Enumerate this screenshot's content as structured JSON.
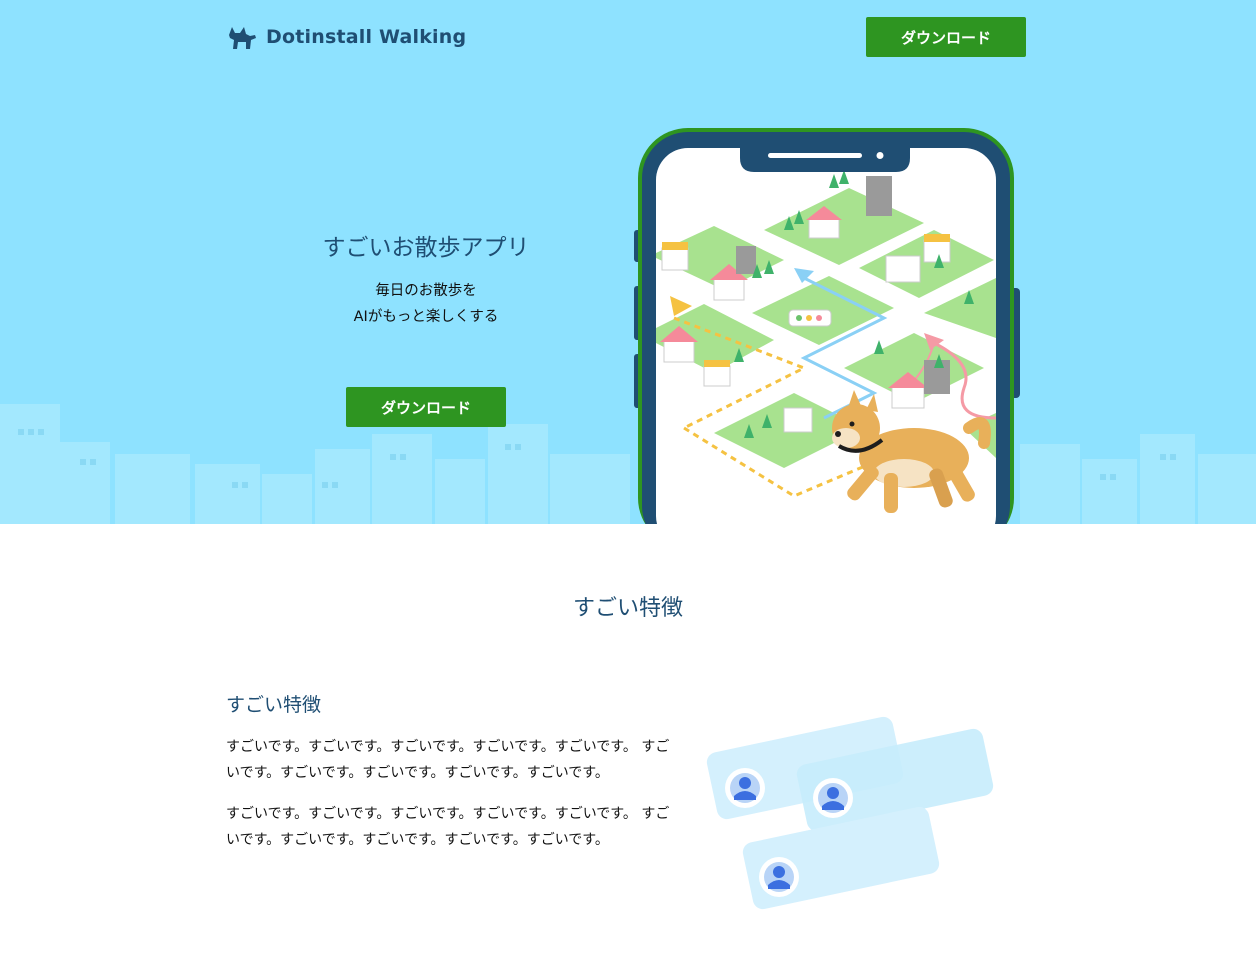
{
  "header": {
    "logo_text": "Dotinstall Walking",
    "download_label": "ダウンロード"
  },
  "hero": {
    "title": "すごいお散歩アプリ",
    "subtitle_line1": "毎日のお散歩を",
    "subtitle_line2": "AIがもっと楽しくする",
    "download_label": "ダウンロード"
  },
  "features": {
    "section_title": "すごい特徴",
    "items": [
      {
        "heading": "すごい特徴",
        "paragraph1": "すごいです。すごいです。すごいです。すごいです。すごいです。 すごいです。すごいです。すごいです。すごいです。すごいです。",
        "paragraph2": "すごいです。すごいです。すごいです。すごいです。すごいです。 すごいです。すごいです。すごいです。すごいです。すごいです。"
      }
    ]
  },
  "colors": {
    "hero_bg": "#8ee2ff",
    "brand_navy": "#1f4e73",
    "button_green": "#2e9521"
  },
  "icons": [
    "dog-logo-icon",
    "phone-map-illustration",
    "user-avatar-icon"
  ]
}
